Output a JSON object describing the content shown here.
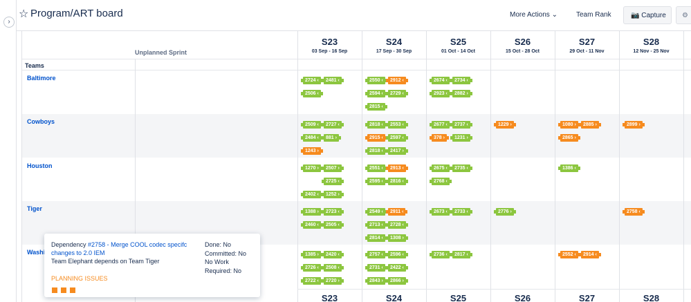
{
  "header": {
    "title": "Program/ART board",
    "more_actions": "More Actions ⌄",
    "team_rank": "Team Rank",
    "capture": "📷 Capture",
    "settings_icon": "gear-icon"
  },
  "board": {
    "unplanned_label": "Unplanned Sprint",
    "teams_label": "Teams",
    "sprints": [
      {
        "name": "S23",
        "dates": "03 Sep - 16 Sep"
      },
      {
        "name": "S24",
        "dates": "17 Sep - 30 Sep"
      },
      {
        "name": "S25",
        "dates": "01 Oct - 14 Oct"
      },
      {
        "name": "S26",
        "dates": "15 Oct - 28 Oct"
      },
      {
        "name": "S27",
        "dates": "29 Oct - 11 Nov"
      },
      {
        "name": "S28",
        "dates": "12 Nov - 25 Nov"
      }
    ],
    "teams": [
      "Baltimore",
      "Cowboys",
      "Houston",
      "Tiger",
      "Washi"
    ]
  },
  "chips": [
    {
      "label": "2724 ‹",
      "color": "green"
    },
    {
      "label": "2481 ‹",
      "color": "green"
    },
    {
      "label": "2506 ‹",
      "color": "green"
    },
    {
      "label": "2550 ‹",
      "color": "green"
    },
    {
      "label": "2912 ‹",
      "color": "orange"
    },
    {
      "label": "2594 ‹",
      "color": "green"
    },
    {
      "label": "2729 ‹",
      "color": "green"
    },
    {
      "label": "2815 ‹",
      "color": "green"
    },
    {
      "label": "2674 ‹",
      "color": "green"
    },
    {
      "label": "2734 ‹",
      "color": "green"
    },
    {
      "label": "2923 ‹",
      "color": "green"
    },
    {
      "label": "2882 ›",
      "color": "green"
    },
    {
      "label": "2509 ‹",
      "color": "green"
    },
    {
      "label": "2727 ‹",
      "color": "green"
    },
    {
      "label": "2484 ‹",
      "color": "green"
    },
    {
      "label": "881 ›",
      "color": "green"
    },
    {
      "label": "1243 ›",
      "color": "orange"
    },
    {
      "label": "2818 ‹",
      "color": "green"
    },
    {
      "label": "2553 ‹",
      "color": "green"
    },
    {
      "label": "2915 ‹",
      "color": "orange"
    },
    {
      "label": "2597 ‹",
      "color": "green"
    },
    {
      "label": "2818 ‹",
      "color": "green"
    },
    {
      "label": "2417 ›",
      "color": "green"
    },
    {
      "label": "2677 ‹",
      "color": "green"
    },
    {
      "label": "2737 ‹",
      "color": "green"
    },
    {
      "label": "378 ›",
      "color": "orange"
    },
    {
      "label": "1231 ›",
      "color": "green"
    },
    {
      "label": "1229 ›",
      "color": "orange"
    },
    {
      "label": "1080 ›",
      "color": "orange"
    },
    {
      "label": "2885 ›",
      "color": "orange"
    },
    {
      "label": "2865 ›",
      "color": "orange"
    },
    {
      "label": "2899 ›",
      "color": "orange"
    },
    {
      "label": "1270 ›",
      "color": "green"
    },
    {
      "label": "2507 ›",
      "color": "green"
    },
    {
      "label": "2725 ‹",
      "color": "green"
    },
    {
      "label": "2402 ‹",
      "color": "green"
    },
    {
      "label": "1252 ›",
      "color": "green"
    },
    {
      "label": "2551 ‹",
      "color": "green"
    },
    {
      "label": "2913 ‹",
      "color": "orange"
    },
    {
      "label": "2595 ‹",
      "color": "green"
    },
    {
      "label": "2816 ‹",
      "color": "green"
    },
    {
      "label": "2675 ‹",
      "color": "green"
    },
    {
      "label": "2735 ‹",
      "color": "green"
    },
    {
      "label": "2768 ‹",
      "color": "green"
    },
    {
      "label": "1386 ‹",
      "color": "green"
    },
    {
      "label": "1388 ›",
      "color": "green"
    },
    {
      "label": "2723 ‹",
      "color": "green"
    },
    {
      "label": "2460 ‹",
      "color": "green"
    },
    {
      "label": "2505 ‹",
      "color": "green"
    },
    {
      "label": "2549 ‹",
      "color": "green"
    },
    {
      "label": "2911 ‹",
      "color": "orange"
    },
    {
      "label": "2713 ‹",
      "color": "green"
    },
    {
      "label": "2728 ‹",
      "color": "green"
    },
    {
      "label": "2814 ‹",
      "color": "green"
    },
    {
      "label": "1308 ›",
      "color": "green"
    },
    {
      "label": "2673 ‹",
      "color": "green"
    },
    {
      "label": "2733 ‹",
      "color": "green"
    },
    {
      "label": "2776 ›",
      "color": "green"
    },
    {
      "label": "2758 ‹",
      "color": "orange"
    },
    {
      "label": "1385 ›",
      "color": "green"
    },
    {
      "label": "2420 ‹",
      "color": "green"
    },
    {
      "label": "2726 ‹",
      "color": "green"
    },
    {
      "label": "2508 ‹",
      "color": "green"
    },
    {
      "label": "2722 ‹",
      "color": "green"
    },
    {
      "label": "2720 ›",
      "color": "green"
    },
    {
      "label": "2757 ‹",
      "color": "green"
    },
    {
      "label": "2596 ‹",
      "color": "green"
    },
    {
      "label": "2731 ‹",
      "color": "green"
    },
    {
      "label": "2422 ‹",
      "color": "green"
    },
    {
      "label": "2843 ›",
      "color": "green"
    },
    {
      "label": "2866 ›",
      "color": "green"
    },
    {
      "label": "2736 ‹",
      "color": "green"
    },
    {
      "label": "2817 ‹",
      "color": "green"
    },
    {
      "label": "2552 ‹",
      "color": "orange"
    },
    {
      "label": "2914 ‹",
      "color": "orange"
    }
  ],
  "tooltip": {
    "prefix": "Dependency ",
    "link": "#2758 - Merge COOL codec specifc changes to 2.0 IEM",
    "desc": "Team Elephant depends on Team Tiger",
    "done": "Done: No",
    "committed": "Committed: No",
    "no_work": "No Work",
    "required": "Required: No",
    "issues_label": "PLANNING ISSUES"
  },
  "colors": {
    "green": "#8cc63f",
    "orange": "#f68b1f",
    "link": "#0052cc"
  }
}
